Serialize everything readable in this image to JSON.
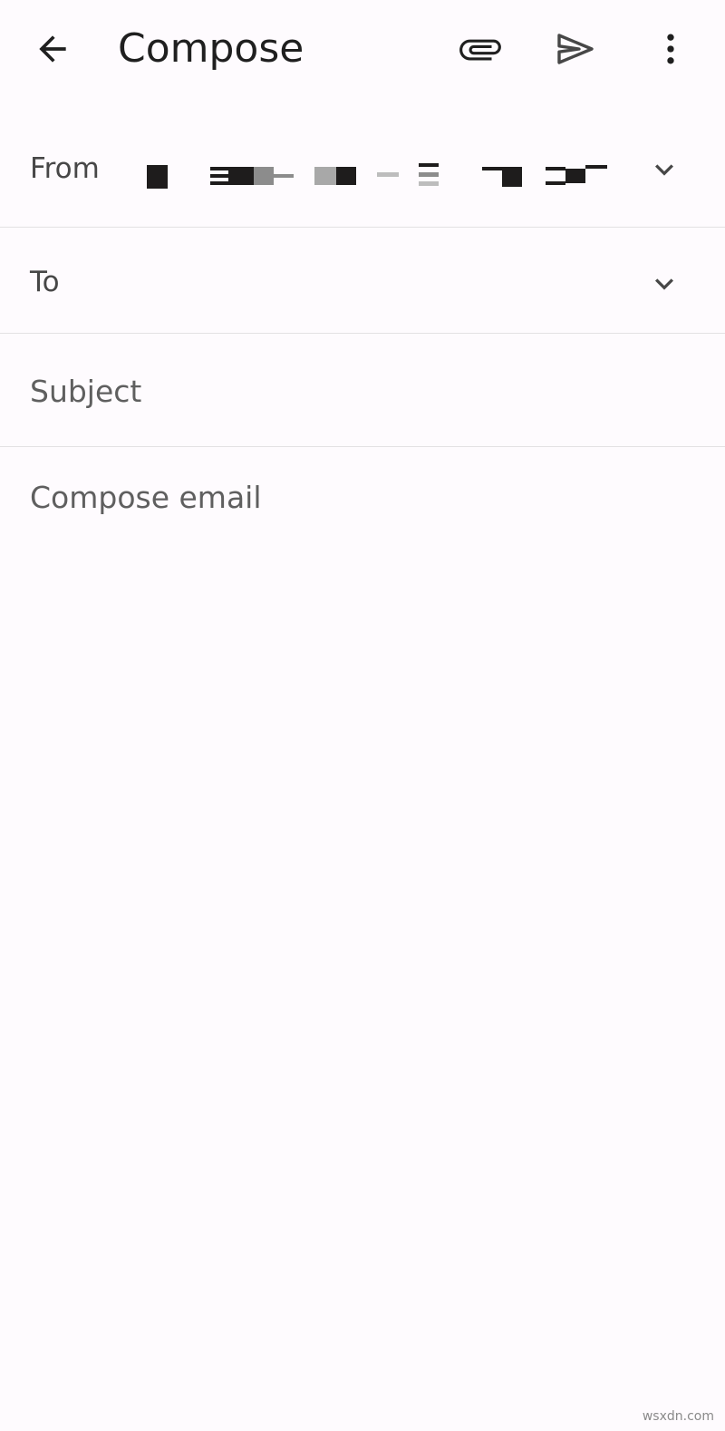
{
  "header": {
    "title": "Compose",
    "icons": {
      "back": "arrow-back-icon",
      "attach": "paperclip-icon",
      "send": "send-icon",
      "more": "more-vert-icon"
    }
  },
  "from": {
    "label": "From",
    "value_redacted": true
  },
  "to": {
    "label": "To",
    "value": ""
  },
  "subject": {
    "placeholder": "Subject",
    "value": ""
  },
  "body": {
    "placeholder": "Compose email",
    "value": ""
  },
  "watermark": "wsxdn.com",
  "colors": {
    "background": "#fefbfe",
    "divider": "#e3e1e3",
    "icon": "#474747",
    "text_primary": "#1f1f1f",
    "text_secondary": "#5f5f5f"
  }
}
